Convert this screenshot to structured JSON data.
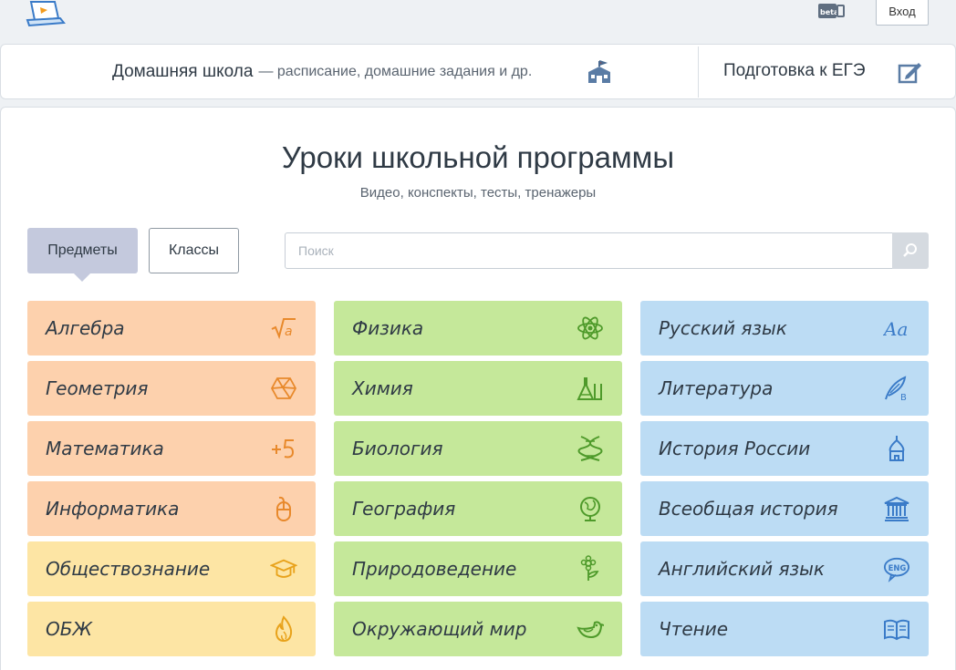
{
  "header": {
    "login_label": "Вход",
    "beta_label": "beta"
  },
  "strip": {
    "home_title": "Домашняя школа",
    "home_subtitle": "— расписание, домашние задания и др.",
    "ege_label": "Подготовка к ЕГЭ"
  },
  "main": {
    "title": "Уроки школьной программы",
    "subtitle": "Видео, конспекты, тесты, тренажеры",
    "tabs": [
      {
        "label": "Предметы",
        "active": true
      },
      {
        "label": "Классы",
        "active": false
      }
    ],
    "search_placeholder": "Поиск"
  },
  "subjects": [
    {
      "label": "Алгебра",
      "icon": "sqrt-a-icon",
      "color": "#fdd1ad"
    },
    {
      "label": "Геометрия",
      "icon": "polyhedron-icon",
      "color": "#fdd1ad"
    },
    {
      "label": "Математика",
      "icon": "plus-five-icon",
      "color": "#fdd1ad"
    },
    {
      "label": "Информатика",
      "icon": "mouse-icon",
      "color": "#fdd1ad"
    },
    {
      "label": "Обществознание",
      "icon": "graduation-cap-icon",
      "color": "#fde5a4"
    },
    {
      "label": "ОБЖ",
      "icon": "fire-icon",
      "color": "#fde5a4"
    },
    {
      "label": "Физика",
      "icon": "atom-icon",
      "color": "#c5e89a"
    },
    {
      "label": "Химия",
      "icon": "flask-icon",
      "color": "#c5e89a"
    },
    {
      "label": "Биология",
      "icon": "dna-icon",
      "color": "#c5e89a"
    },
    {
      "label": "География",
      "icon": "globe-icon",
      "color": "#c5e89a"
    },
    {
      "label": "Природоведение",
      "icon": "flower-icon",
      "color": "#c5e89a"
    },
    {
      "label": "Окружающий мир",
      "icon": "bird-icon",
      "color": "#c5e89a"
    },
    {
      "label": "Русский язык",
      "icon": "letters-aa-icon",
      "color": "#bcdcf4"
    },
    {
      "label": "Литература",
      "icon": "quill-icon",
      "color": "#bcdcf4"
    },
    {
      "label": "История России",
      "icon": "church-dome-icon",
      "color": "#bcdcf4"
    },
    {
      "label": "Всеобщая история",
      "icon": "columns-icon",
      "color": "#bcdcf4"
    },
    {
      "label": "Английский язык",
      "icon": "eng-bubble-icon",
      "color": "#bcdcf4"
    },
    {
      "label": "Чтение",
      "icon": "book-icon",
      "color": "#bcdcf4"
    }
  ]
}
